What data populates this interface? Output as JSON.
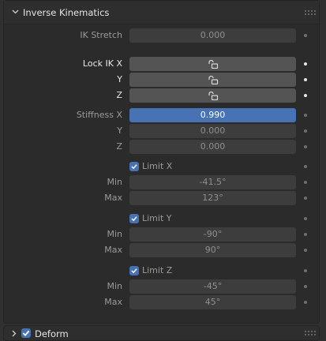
{
  "panel": {
    "title": "Inverse Kinematics"
  },
  "ik_stretch": {
    "label": "IK Stretch",
    "value": "0.000"
  },
  "lock_ik": {
    "x_label": "Lock IK X",
    "y_label": "Y",
    "z_label": "Z",
    "x_icon": "unlock-icon",
    "y_icon": "unlock-icon",
    "z_icon": "unlock-icon"
  },
  "stiffness": {
    "x_label": "Stiffness X",
    "x_value": "0.990",
    "y_label": "Y",
    "y_value": "0.000",
    "z_label": "Z",
    "z_value": "0.000"
  },
  "limit_x": {
    "label": "Limit X",
    "checked": true,
    "min_label": "Min",
    "min_value": "-41.5°",
    "max_label": "Max",
    "max_value": "123°"
  },
  "limit_y": {
    "label": "Limit Y",
    "checked": true,
    "min_label": "Min",
    "min_value": "-90°",
    "max_label": "Max",
    "max_value": "90°"
  },
  "limit_z": {
    "label": "Limit Z",
    "checked": true,
    "min_label": "Min",
    "min_value": "-45°",
    "max_label": "Max",
    "max_value": "45°"
  },
  "deform": {
    "title": "Deform",
    "checked": true
  },
  "colors": {
    "accent": "#4772b3",
    "panel_bg": "#2b2b2b",
    "field_bg": "#545454",
    "field_disabled_bg": "#3d3d3d"
  }
}
